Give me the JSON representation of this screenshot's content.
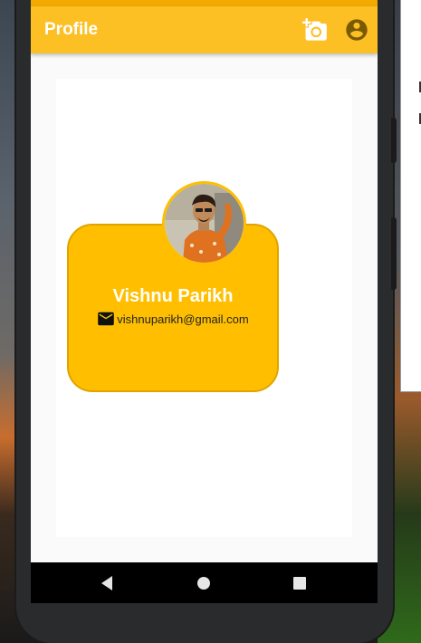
{
  "status_bar": {
    "text": ""
  },
  "app_bar": {
    "title": "Profile",
    "actions": [
      {
        "icon": "add-photo-icon"
      },
      {
        "icon": "account-circle-icon"
      }
    ]
  },
  "profile": {
    "name": "Vishnu Parikh",
    "email": "vishnuparikh@gmail.com",
    "email_icon": "mail-icon",
    "avatar_icon": "avatar-photo"
  },
  "nav_bar": {
    "buttons": [
      {
        "icon": "back-icon"
      },
      {
        "icon": "home-icon"
      },
      {
        "icon": "recents-icon"
      }
    ]
  },
  "colors": {
    "app_bar": "#fcbf24",
    "card": "#ffbf00",
    "card_border": "#e0a400",
    "title_text": "#ffffff"
  }
}
